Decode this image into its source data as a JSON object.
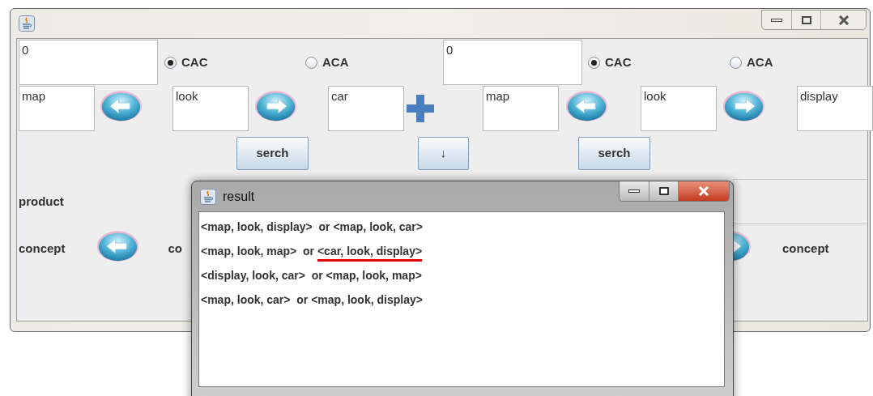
{
  "main_window": {
    "option_row": [
      {
        "kind": "field",
        "value": "0"
      },
      {
        "kind": "radio",
        "label": "CAC",
        "selected": true
      },
      {
        "kind": "radio",
        "label": "ACA",
        "selected": false
      },
      {
        "kind": "field",
        "value": "0"
      },
      {
        "kind": "radio",
        "label": "CAC",
        "selected": true
      },
      {
        "kind": "radio",
        "label": "ACA",
        "selected": false
      }
    ],
    "term_row": [
      {
        "kind": "field",
        "value": "map"
      },
      {
        "kind": "arrow_left"
      },
      {
        "kind": "field",
        "value": "look"
      },
      {
        "kind": "arrow_right"
      },
      {
        "kind": "field",
        "value": "car"
      },
      {
        "kind": "plus"
      },
      {
        "kind": "field",
        "value": "map"
      },
      {
        "kind": "arrow_left"
      },
      {
        "kind": "field",
        "value": "look"
      },
      {
        "kind": "arrow_right"
      },
      {
        "kind": "field",
        "value": "display"
      }
    ],
    "button_row": [
      {
        "label": "serch"
      },
      {
        "label": "↓"
      },
      {
        "label": "serch"
      }
    ],
    "product_label": "product",
    "concept_row": [
      {
        "kind": "label",
        "text": "concept"
      },
      {
        "kind": "arrow_left"
      },
      {
        "kind": "label",
        "text": "co"
      },
      {
        "kind": "arrow_right"
      },
      {
        "kind": "label",
        "text": "concept"
      }
    ]
  },
  "result_dialog": {
    "title": "result",
    "lines": [
      {
        "first": "<map, look, display>",
        "joiner": "or",
        "second": "<map, look, car>",
        "underlined": false
      },
      {
        "first": "<map, look, map>",
        "joiner": "or",
        "second": "<car, look, display>",
        "underlined": true
      },
      {
        "first": "<display, look, car>",
        "joiner": "or",
        "second": "<map, look, map>",
        "underlined": false
      },
      {
        "first": "<map, look, car>",
        "joiner": "or",
        "second": "<map, look, display>",
        "underlined": false
      }
    ]
  }
}
